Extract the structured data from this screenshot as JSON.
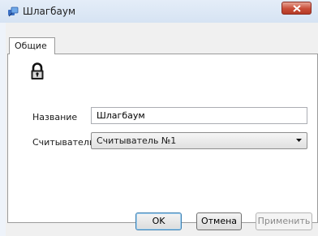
{
  "window": {
    "title": "Шлагбаум",
    "app_icon": "reader-app-icon",
    "close_icon": "close-icon",
    "close_color": "#c94d38"
  },
  "tabs": [
    {
      "label": "Общие",
      "selected": true
    }
  ],
  "general": {
    "icon": "lock-icon",
    "name_label": "Название",
    "name_value": "Шлагбаум",
    "reader_label": "Считыватель",
    "reader_value": "Считыватель №1"
  },
  "buttons": {
    "ok": "OK",
    "cancel": "Отмена",
    "apply": "Применить",
    "apply_enabled": false
  }
}
